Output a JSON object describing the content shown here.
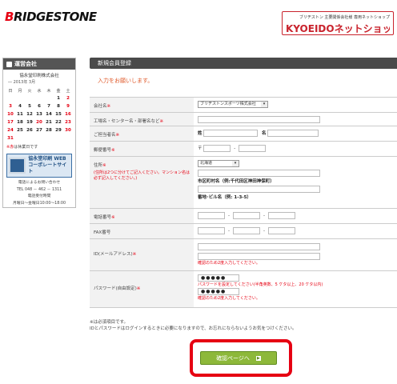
{
  "header": {
    "logo_prefix": "B",
    "logo_rest": "RIDGESTONE",
    "shop_subtitle": "ブリヂストン 主要関係会社様 専用ネットショップ",
    "shop_name": "KYOEIDOネットショップ"
  },
  "sidebar": {
    "heading": "運営会社",
    "company": "協永堂印刷株式会社",
    "year_month": "― 2013年 3月",
    "weekdays": [
      "日",
      "月",
      "火",
      "水",
      "木",
      "金",
      "土"
    ],
    "weeks": [
      [
        "",
        "",
        "",
        "",
        "",
        "1",
        "2"
      ],
      [
        "3",
        "4",
        "5",
        "6",
        "7",
        "8",
        "9"
      ],
      [
        "10",
        "11",
        "12",
        "13",
        "14",
        "15",
        "16"
      ],
      [
        "17",
        "18",
        "19",
        "20",
        "21",
        "22",
        "23"
      ],
      [
        "24",
        "25",
        "26",
        "27",
        "28",
        "29",
        "30"
      ],
      [
        "31",
        "",
        "",
        "",
        "",
        "",
        ""
      ]
    ],
    "cal_note_mark": "※赤",
    "cal_note_text": "は休業日です",
    "web_button_line1": "協永堂印刷 WEB",
    "web_button_line2": "コーポレートサイト",
    "contact_line1": "電話によるお問い合わせ",
    "contact_line2": "TEL 048 － 462 － 1311",
    "contact_line3": "電話受付時間",
    "contact_line4": "月曜日～金曜日10:00～18:00"
  },
  "main": {
    "title": "新規会員登録",
    "intro": "入力をお願いします。",
    "fields": {
      "company_label": "会社名",
      "company_value": "ブリヂストンスポーツ株式会社",
      "dept_label": "工場名・センター名・部署名など",
      "name_label": "ご担当者名",
      "last_name_label": "姓",
      "first_name_label": "名",
      "zip_label": "郵便番号",
      "zip_prefix": "〒",
      "address_label": "住所",
      "address_note": "(住所は2つに分けてご記入ください。マンション名は必ず記入してください。)",
      "prefecture_value": "北海道",
      "city_hint": "市区町村名（例:千代田区神田神保町）",
      "street_hint": "番地･ビル名（例: 1-3-5）",
      "phone_label": "電話番号",
      "fax_label": "FAX番号",
      "email_label": "ID(メールアドレス)",
      "email_confirm_error": "確認のため2度入力してください。",
      "password_label": "パスワード(自由設定)",
      "password_value": "●●●●●",
      "password_hint": "パスワードを設定してください(半角英数、5 ケタ以上、20 ケタ以内)",
      "password_confirm_value": "●●●●●",
      "password_confirm_error": "確認のため2度入力してください。",
      "required_mark": "※"
    },
    "footnote1": "※は必須項目です。",
    "footnote2": "IDとパスワードはログインするときに必要になりますので、お忘れにならないようお気をつけください。",
    "confirm_button": "確認ページへ",
    "confirm_arrow": "▶"
  }
}
